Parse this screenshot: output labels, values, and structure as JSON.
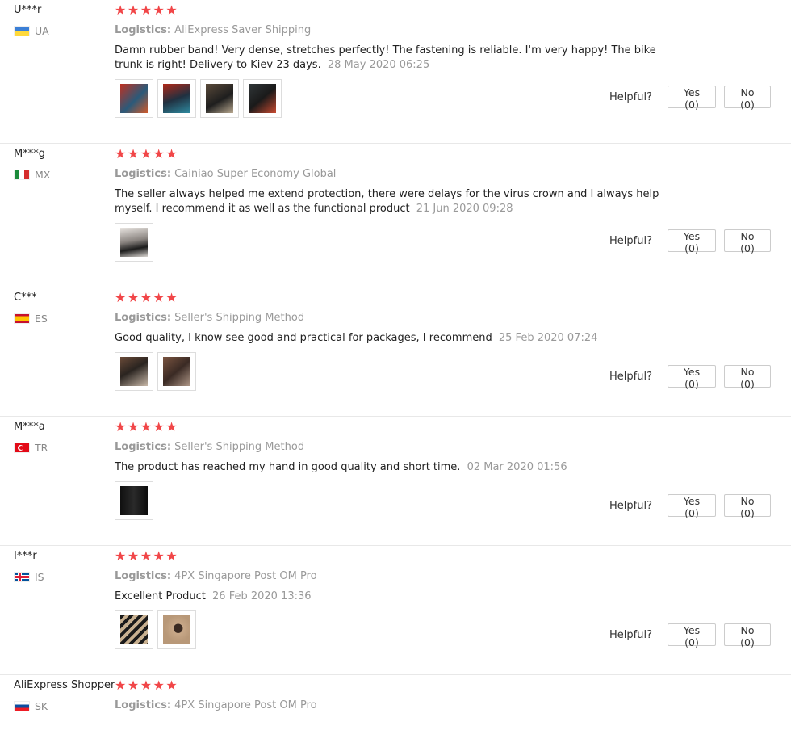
{
  "reviews": [
    {
      "user": "U***r",
      "country": "UA",
      "rating": "★★★★★",
      "logistics_label": "Logistics:",
      "logistics": "AliExpress Saver Shipping",
      "text": "Damn rubber band! Very dense, stretches perfectly! The fastening is reliable. I'm very happy! The bike trunk is right! Delivery to Kiev 23 days.",
      "date": "28 May 2020 06:25",
      "photos": [
        "photo-red-blue",
        "photo-red-blue",
        "photo-dark",
        "photo-dark"
      ],
      "helpful_label": "Helpful?",
      "yes": "Yes (0)",
      "no": "No (0)"
    },
    {
      "user": "M***g",
      "country": "MX",
      "rating": "★★★★★",
      "logistics_label": "Logistics:",
      "logistics": "Cainiao Super Economy Global",
      "text": "The seller always helped me extend protection, there were delays for the virus crown and I always help myself. I recommend it as well as the functional product",
      "date": "21 Jun 2020 09:28",
      "photos": [
        "photo-gray"
      ],
      "helpful_label": "Helpful?",
      "yes": "Yes (0)",
      "no": "No (0)"
    },
    {
      "user": "C***",
      "country": "ES",
      "rating": "★★★★★",
      "logistics_label": "Logistics:",
      "logistics": "Seller's Shipping Method",
      "text": "Good quality, I know see good and practical for packages, I recommend",
      "date": "25 Feb 2020 07:24",
      "photos": [
        "photo-brown",
        "photo-brown"
      ],
      "helpful_label": "Helpful?",
      "yes": "Yes (0)",
      "no": "No (0)"
    },
    {
      "user": "M***a",
      "country": "TR",
      "rating": "★★★★★",
      "logistics_label": "Logistics:",
      "logistics": "Seller's Shipping Method",
      "text": "The product has reached my hand in good quality and short time.",
      "date": "02 Mar 2020 01:56",
      "photos": [
        "photo-black"
      ],
      "helpful_label": "Helpful?",
      "yes": "Yes (0)",
      "no": "No (0)"
    },
    {
      "user": "I***r",
      "country": "IS",
      "rating": "★★★★★",
      "logistics_label": "Logistics:",
      "logistics": "4PX Singapore Post OM Pro",
      "text": "Excellent Product",
      "date": "26 Feb 2020 13:36",
      "photos": [
        "photo-stripes",
        "photo-tan"
      ],
      "helpful_label": "Helpful?",
      "yes": "Yes (0)",
      "no": "No (0)"
    },
    {
      "user": "AliExpress Shopper",
      "country": "SK",
      "rating": "★★★★★",
      "logistics_label": "Logistics:",
      "logistics": "4PX Singapore Post OM Pro",
      "text": "",
      "date": "",
      "photos": [],
      "helpful_label": "",
      "yes": "",
      "no": ""
    }
  ],
  "colors": {
    "star": "#f14648",
    "muted": "#999999",
    "divider": "#e8e8e8"
  }
}
